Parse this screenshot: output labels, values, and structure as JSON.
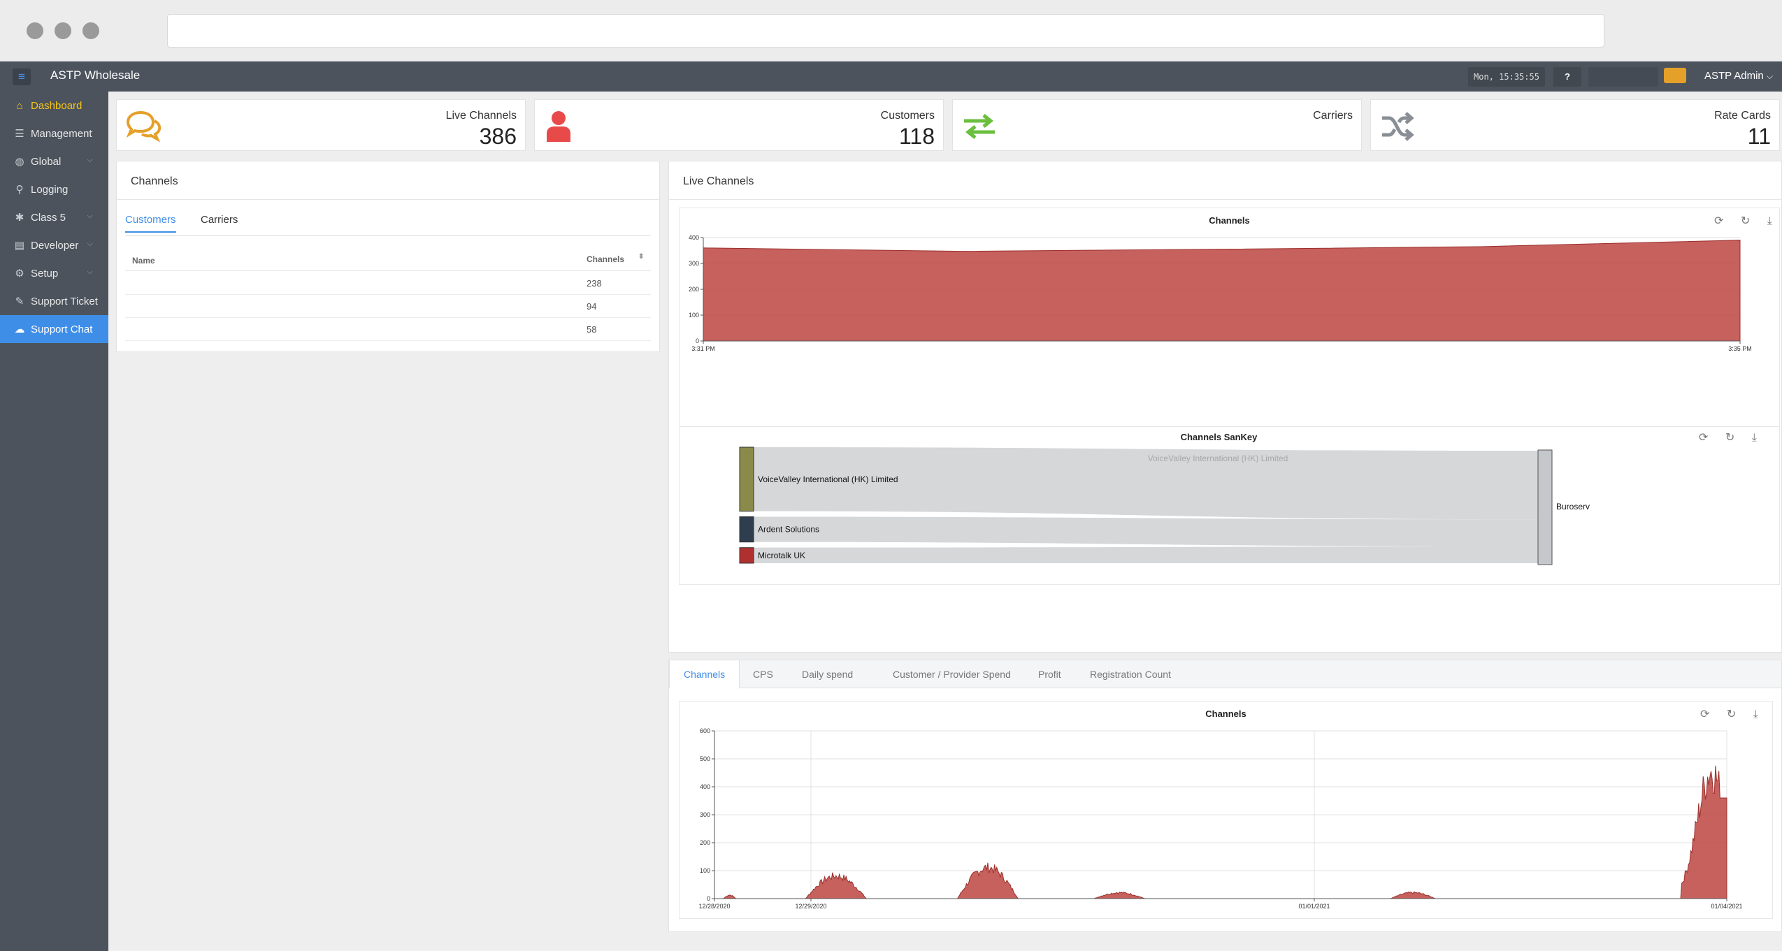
{
  "app": {
    "title": "ASTP Wholesale"
  },
  "topbar": {
    "clock": "Mon, 15:35:55",
    "help": "?",
    "user": "ASTP Admin",
    "user_caret": "⌵"
  },
  "sidebar": {
    "items": [
      {
        "label": "Dashboard",
        "icon": "home-icon"
      },
      {
        "label": "Management",
        "icon": "list-icon"
      },
      {
        "label": "Global",
        "icon": "globe-icon"
      },
      {
        "label": "Logging",
        "icon": "search-icon"
      },
      {
        "label": "Class 5",
        "icon": "asterisk-icon"
      },
      {
        "label": "Developer",
        "icon": "file-code-icon"
      },
      {
        "label": "Setup",
        "icon": "cogs-icon"
      },
      {
        "label": "Support Ticket",
        "icon": "ticket-icon"
      },
      {
        "label": "Support Chat",
        "icon": "chat-icon"
      }
    ]
  },
  "stats": [
    {
      "label": "Live Channels",
      "value": "386",
      "icon": "chat-bubbles-icon",
      "color": "#e5a02a"
    },
    {
      "label": "Customers",
      "value": "118",
      "icon": "user-icon",
      "color": "#e84a4a"
    },
    {
      "label": "Carriers",
      "value": "",
      "icon": "exchange-arrows-icon",
      "color": "#6abf3d"
    },
    {
      "label": "Rate Cards",
      "value": "11",
      "icon": "shuffle-icon",
      "color": "#8a8f96"
    }
  ],
  "channels_panel": {
    "title": "Channels",
    "tabs": [
      "Customers",
      "Carriers"
    ],
    "columns": [
      "Name",
      "Channels"
    ],
    "rows": [
      {
        "name": "",
        "channels": "238"
      },
      {
        "name": "",
        "channels": "94"
      },
      {
        "name": "",
        "channels": "58"
      }
    ]
  },
  "live_panel": {
    "title": "Live Channels",
    "tools": "⟳ ↻ ⤓"
  },
  "bottom_tabs": [
    "Channels",
    "CPS",
    "Daily spend",
    "Customer / Provider Spend",
    "Profit",
    "Registration Count"
  ],
  "chart_data": [
    {
      "type": "area",
      "title": "Channels",
      "x": [
        "3:31 PM",
        "3:32 PM",
        "3:33 PM",
        "3:34 PM",
        "3:35 PM"
      ],
      "y": [
        360,
        347,
        355,
        365,
        390
      ],
      "x_tick_labels": [
        "3:31 PM",
        "3:35 PM"
      ],
      "ylim": [
        0,
        400
      ],
      "y_ticks": [
        0,
        100,
        200,
        300,
        400
      ],
      "color": "#c0504d",
      "grid": true
    },
    {
      "type": "sankey",
      "title": "Channels SanKey",
      "sources": [
        {
          "name": "VoiceValley International (HK) Limited",
          "value": 238,
          "color": "#8a8a4a"
        },
        {
          "name": "Ardent Solutions",
          "value": 94,
          "color": "#2e3e4e"
        },
        {
          "name": "Microtalk UK",
          "value": 58,
          "color": "#b03030"
        }
      ],
      "target": {
        "name": "Buroserv",
        "color": "#c4c8cc"
      },
      "hover_label": "VoiceValley International (HK) Limited"
    },
    {
      "type": "area",
      "title": "Channels",
      "x_tick_labels": [
        "12/28/2020",
        "12/29/2020",
        "01/01/2021",
        "01/04/2021"
      ],
      "ylim": [
        0,
        600
      ],
      "y_ticks": [
        0,
        100,
        200,
        300,
        400,
        500,
        600
      ],
      "color": "#c0504d",
      "grid": true,
      "peaks": [
        {
          "x": 0.015,
          "y": 15
        },
        {
          "x": 0.12,
          "y": 95
        },
        {
          "x": 0.27,
          "y": 130
        },
        {
          "x": 0.4,
          "y": 25
        },
        {
          "x": 0.69,
          "y": 25
        },
        {
          "x": 0.985,
          "y": 535
        }
      ]
    }
  ]
}
